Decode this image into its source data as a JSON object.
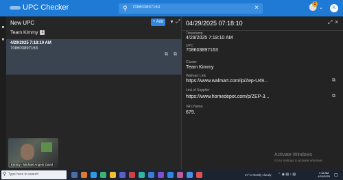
{
  "header": {
    "app_title": "UPC Checker",
    "search_value": "708603897163",
    "notification_count": "1",
    "avatar_initials": "K"
  },
  "list": {
    "title": "New UPC",
    "add_label": "+ Add",
    "group_label": "Team Kimmy",
    "group_count": "1",
    "item": {
      "date": "4/29/2025 7:18:10 AM",
      "upc": "708603897163"
    }
  },
  "video": {
    "label": "Kimmy - Michael Angelo David"
  },
  "detail": {
    "title": "04/29/2025 07:18:10",
    "fields": [
      {
        "label": "Timestamp",
        "value": "4/29/2025 7:18:10 AM"
      },
      {
        "label": "UPC",
        "value": "708603897163"
      },
      {
        "label": "Cluster",
        "value": "Team Kimmy"
      },
      {
        "label": "Walmart Link",
        "value": "https://www.walmart.com/ip/Zep-U49..."
      },
      {
        "label": "Link of Supplier",
        "value": "https://www.homedepot.com/p/ZEP-3..."
      },
      {
        "label": "VA's Name",
        "value": "679."
      }
    ]
  },
  "os_watermark": {
    "title": "Activate Windows",
    "subtitle": "Go to Settings to activate Windows."
  },
  "taskbar": {
    "search_placeholder": "Type here to search",
    "weather": "27°C  Mostly cloudy",
    "time": "7:18 AM",
    "date": "4/29/2025"
  },
  "colors": {
    "accent": "#1f7ad6",
    "selected_row": "#3a4350"
  }
}
